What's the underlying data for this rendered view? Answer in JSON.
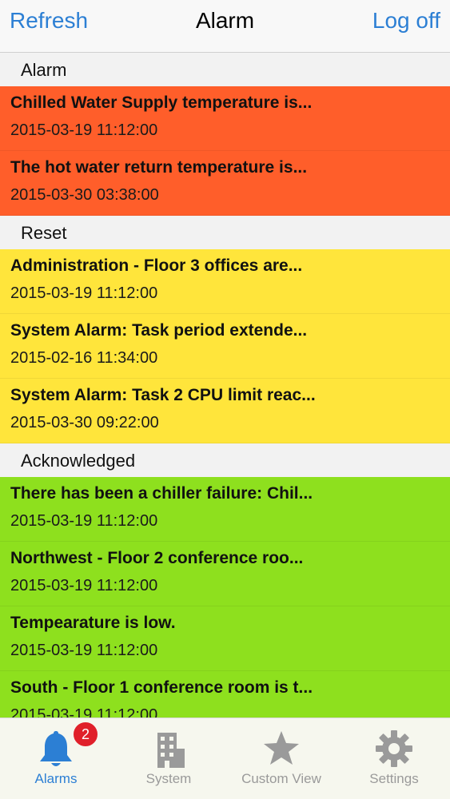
{
  "header": {
    "left_button": "Refresh",
    "title": "Alarm",
    "right_button": "Log off"
  },
  "sections": [
    {
      "title": "Alarm",
      "color": "#ff5e2a",
      "items": [
        {
          "title": "Chilled Water Supply temperature is...",
          "time": "2015-03-19 11:12:00"
        },
        {
          "title": "The hot water return temperature is...",
          "time": "2015-03-30 03:38:00"
        }
      ]
    },
    {
      "title": "Reset",
      "color": "#ffe53b",
      "items": [
        {
          "title": "Administration - Floor 3 offices are...",
          "time": "2015-03-19 11:12:00"
        },
        {
          "title": "System Alarm: Task period extende...",
          "time": "2015-02-16 11:34:00"
        },
        {
          "title": "System Alarm: Task 2 CPU limit reac...",
          "time": "2015-03-30 09:22:00"
        }
      ]
    },
    {
      "title": "Acknowledged",
      "color": "#8ee01e",
      "items": [
        {
          "title": "There has been a chiller failure: Chil...",
          "time": "2015-03-19 11:12:00"
        },
        {
          "title": "Northwest - Floor 2 conference roo...",
          "time": "2015-03-19 11:12:00"
        },
        {
          "title": "Tempearature is low.",
          "time": "2015-03-19 11:12:00"
        },
        {
          "title": "South - Floor 1 conference room is t...",
          "time": "2015-03-19 11:12:00"
        }
      ]
    }
  ],
  "tabs": [
    {
      "label": "Alarms",
      "icon": "bell-icon",
      "badge": "2",
      "active": true
    },
    {
      "label": "System",
      "icon": "building-icon",
      "active": false
    },
    {
      "label": "Custom View",
      "icon": "star-icon",
      "active": false
    },
    {
      "label": "Settings",
      "icon": "gear-icon",
      "active": false
    }
  ],
  "colors": {
    "accent": "#2c7fd4",
    "inactive": "#9a9a9a",
    "badge": "#e0202a"
  }
}
